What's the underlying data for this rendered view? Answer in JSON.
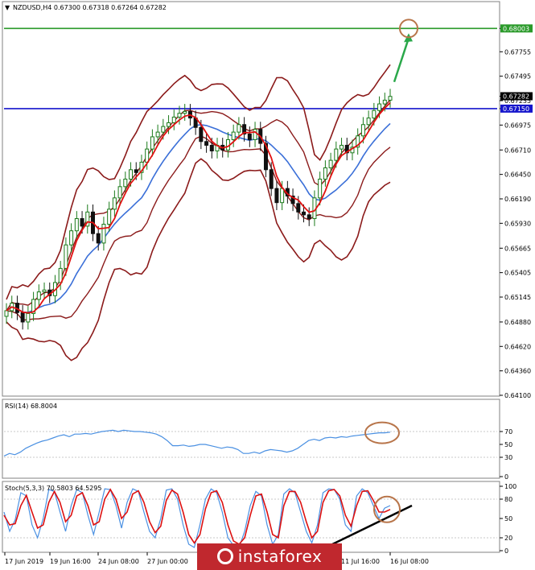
{
  "chart_data": [
    {
      "type": "candlestick",
      "title": "NZDUSD,H4  0.67300 0.67318 0.67264 0.67282",
      "ylim": [
        0.641,
        0.681
      ],
      "y_ticks": [
        "0.68003",
        "0.67755",
        "0.67495",
        "0.67282",
        "0.67235",
        "0.67150",
        "0.66975",
        "0.66710",
        "0.66450",
        "0.66190",
        "0.65930",
        "0.65665",
        "0.65405",
        "0.65145",
        "0.64880",
        "0.64620",
        "0.64360",
        "0.64100"
      ],
      "levels": [
        {
          "name": "green-level",
          "value": 0.68003,
          "label": "0.68003",
          "color": "#2a9a2a"
        },
        {
          "name": "blue-level",
          "value": 0.6715,
          "label": "0.67150",
          "color": "#1515cc"
        },
        {
          "name": "current-price",
          "value": 0.67282,
          "label": "0.67282",
          "color": "#000000"
        }
      ],
      "closes": [
        0.65,
        0.6508,
        0.6498,
        0.6488,
        0.6497,
        0.6512,
        0.652,
        0.6522,
        0.6516,
        0.653,
        0.6545,
        0.657,
        0.6585,
        0.6598,
        0.659,
        0.6605,
        0.6582,
        0.6572,
        0.6592,
        0.6608,
        0.662,
        0.6632,
        0.664,
        0.665,
        0.6647,
        0.6658,
        0.6672,
        0.6685,
        0.669,
        0.6696,
        0.67,
        0.6706,
        0.671,
        0.6712,
        0.6705,
        0.6695,
        0.668,
        0.6676,
        0.667,
        0.6676,
        0.6671,
        0.6682,
        0.669,
        0.6698,
        0.6688,
        0.6682,
        0.6693,
        0.6678,
        0.665,
        0.663,
        0.6615,
        0.663,
        0.6622,
        0.6614,
        0.6605,
        0.6602,
        0.6598,
        0.662,
        0.664,
        0.6652,
        0.666,
        0.6672,
        0.6676,
        0.6668,
        0.6674,
        0.6686,
        0.6698,
        0.6705,
        0.6713,
        0.672,
        0.6724,
        0.6728
      ]
    },
    {
      "type": "line",
      "title": "RSI(14) 68.8004",
      "ylim": [
        0,
        100
      ],
      "y_ticks": [
        "70",
        "50",
        "30",
        "0"
      ],
      "series": [
        {
          "color": "#4a90e2",
          "values": [
            32,
            36,
            34,
            38,
            44,
            48,
            52,
            55,
            57,
            60,
            63,
            65,
            62,
            66,
            66,
            67,
            66,
            68,
            70,
            71,
            72,
            70,
            72,
            71,
            70,
            70,
            69,
            68,
            66,
            62,
            56,
            48,
            48,
            49,
            47,
            48,
            50,
            50,
            48,
            46,
            44,
            46,
            45,
            42,
            36,
            36,
            38,
            36,
            40,
            42,
            41,
            40,
            38,
            40,
            44,
            50,
            56,
            58,
            56,
            60,
            61,
            60,
            62,
            61,
            63,
            64,
            65,
            66,
            67,
            68,
            68,
            69
          ]
        }
      ]
    },
    {
      "type": "line",
      "title": "Stoch(5,3,3) 70.5803 64.5295",
      "ylim": [
        0,
        100
      ],
      "y_ticks": [
        "100",
        "80",
        "50",
        "20",
        "0"
      ],
      "series": [
        {
          "name": "%K",
          "color": "#4a90e2",
          "values": [
            60,
            30,
            48,
            90,
            85,
            40,
            20,
            50,
            95,
            92,
            60,
            30,
            70,
            95,
            90,
            55,
            25,
            60,
            96,
            95,
            70,
            35,
            75,
            96,
            92,
            60,
            30,
            20,
            50,
            94,
            96,
            80,
            40,
            10,
            5,
            40,
            80,
            96,
            90,
            60,
            20,
            8,
            5,
            30,
            70,
            92,
            85,
            40,
            10,
            25,
            88,
            96,
            90,
            60,
            30,
            12,
            40,
            90,
            96,
            95,
            80,
            40,
            30,
            85,
            96,
            90,
            70,
            50,
            66,
            70
          ]
        },
        {
          "name": "%D",
          "color": "#dd1111",
          "values": [
            55,
            40,
            42,
            70,
            86,
            60,
            35,
            40,
            75,
            92,
            75,
            45,
            55,
            85,
            90,
            70,
            40,
            45,
            80,
            95,
            80,
            50,
            60,
            88,
            93,
            75,
            45,
            28,
            38,
            78,
            94,
            88,
            60,
            25,
            12,
            25,
            65,
            90,
            93,
            75,
            40,
            15,
            10,
            20,
            55,
            85,
            88,
            60,
            25,
            20,
            70,
            92,
            92,
            75,
            45,
            20,
            30,
            75,
            93,
            95,
            85,
            55,
            38,
            70,
            92,
            93,
            78,
            60,
            60,
            64
          ]
        }
      ]
    }
  ],
  "x_labels": [
    "17 Jun 2019",
    "19 Jun 16:00",
    "24 Jun 08:00",
    "27 Jun 00:00",
    "11 Jul 16:00",
    "16 Jul 08:00"
  ],
  "watermark": "instaforex",
  "colors": {
    "upper_band": "#8b1a1a",
    "ma_red": "#e01010",
    "ma_blue": "#3a6fd8",
    "bull": "#1a7a1a",
    "bear": "#111111",
    "annotation": "#b8754a",
    "arrow": "#2aa84a"
  }
}
